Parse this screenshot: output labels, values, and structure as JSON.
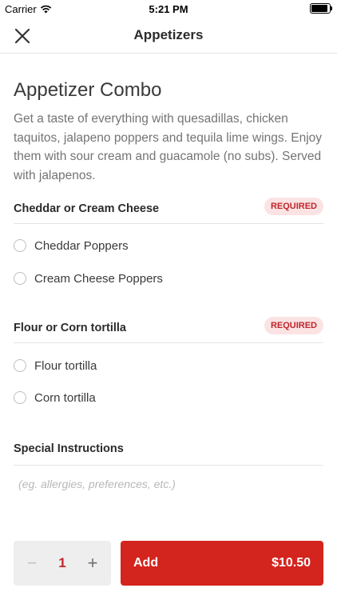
{
  "status_bar": {
    "carrier": "Carrier",
    "time": "5:21 PM",
    "battery_level": 0.9
  },
  "nav": {
    "title": "Appetizers",
    "close_icon": "close-icon"
  },
  "item": {
    "title": "Appetizer Combo",
    "description": "Get a taste of everything with quesadillas, chicken taquitos, jalapeno poppers and tequila lime wings. Enjoy them with sour cream and guacamole (no subs). Served with jalapenos."
  },
  "sections": [
    {
      "label": "Cheddar or Cream Cheese",
      "badge": "REQUIRED",
      "options": [
        "Cheddar Poppers",
        "Cream Cheese Poppers"
      ]
    },
    {
      "label": "Flour or Corn tortilla",
      "badge": "REQUIRED",
      "options": [
        "Flour tortilla",
        "Corn tortilla"
      ]
    }
  ],
  "special_instructions": {
    "label": "Special Instructions",
    "placeholder": "(eg. allergies, preferences, etc.)",
    "value": ""
  },
  "footer": {
    "quantity": "1",
    "minus": "−",
    "plus": "+",
    "add_label": "Add",
    "price": "$10.50"
  },
  "colors": {
    "accent": "#d3241d",
    "badge_bg": "#fbe3e3",
    "badge_text": "#c0262c"
  }
}
